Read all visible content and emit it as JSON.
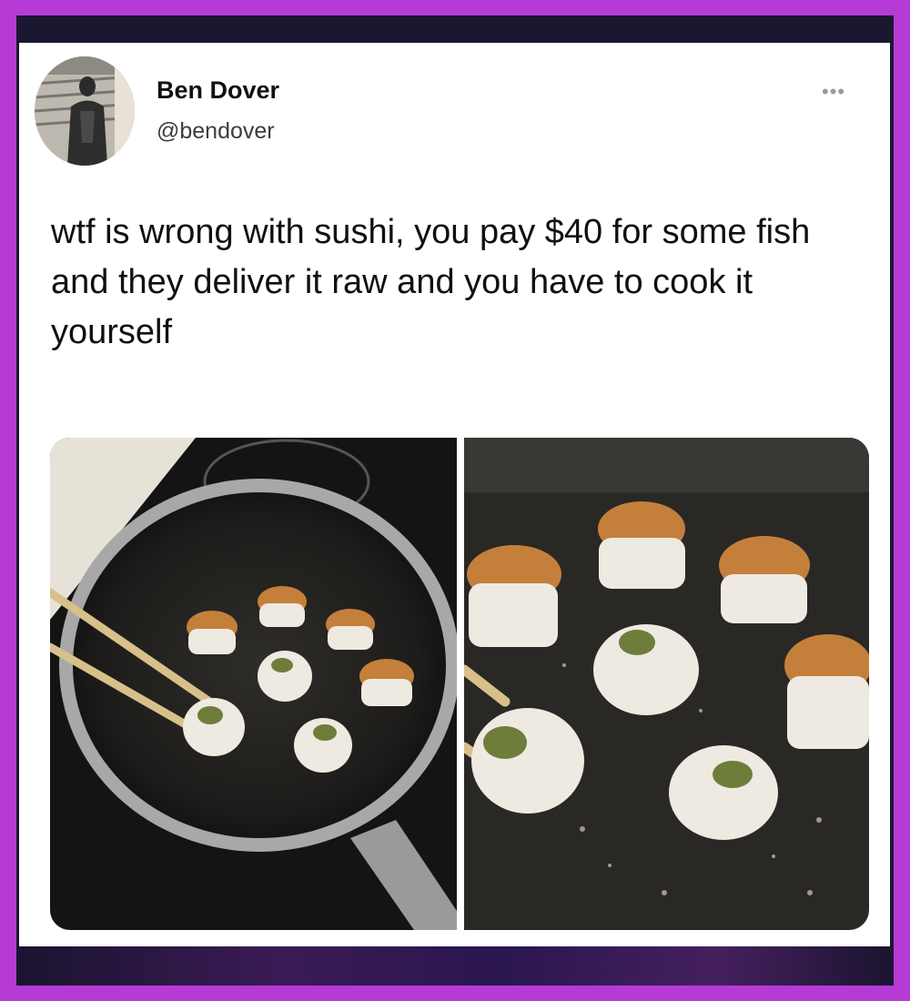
{
  "tweet": {
    "author_name": "Ben Dover",
    "author_handle": "@bendover",
    "more_icon": "ellipsis-icon",
    "text": "wtf is wrong with sushi, you pay $40 for some fish and they deliver it raw and you have to cook it yourself",
    "images": [
      {
        "name": "sushi-pan-photo-1"
      },
      {
        "name": "sushi-pan-photo-2"
      }
    ]
  },
  "colors": {
    "frame": "#b63ad6",
    "card": "#ffffff",
    "text": "#101010",
    "handle": "#3c3c3c"
  }
}
